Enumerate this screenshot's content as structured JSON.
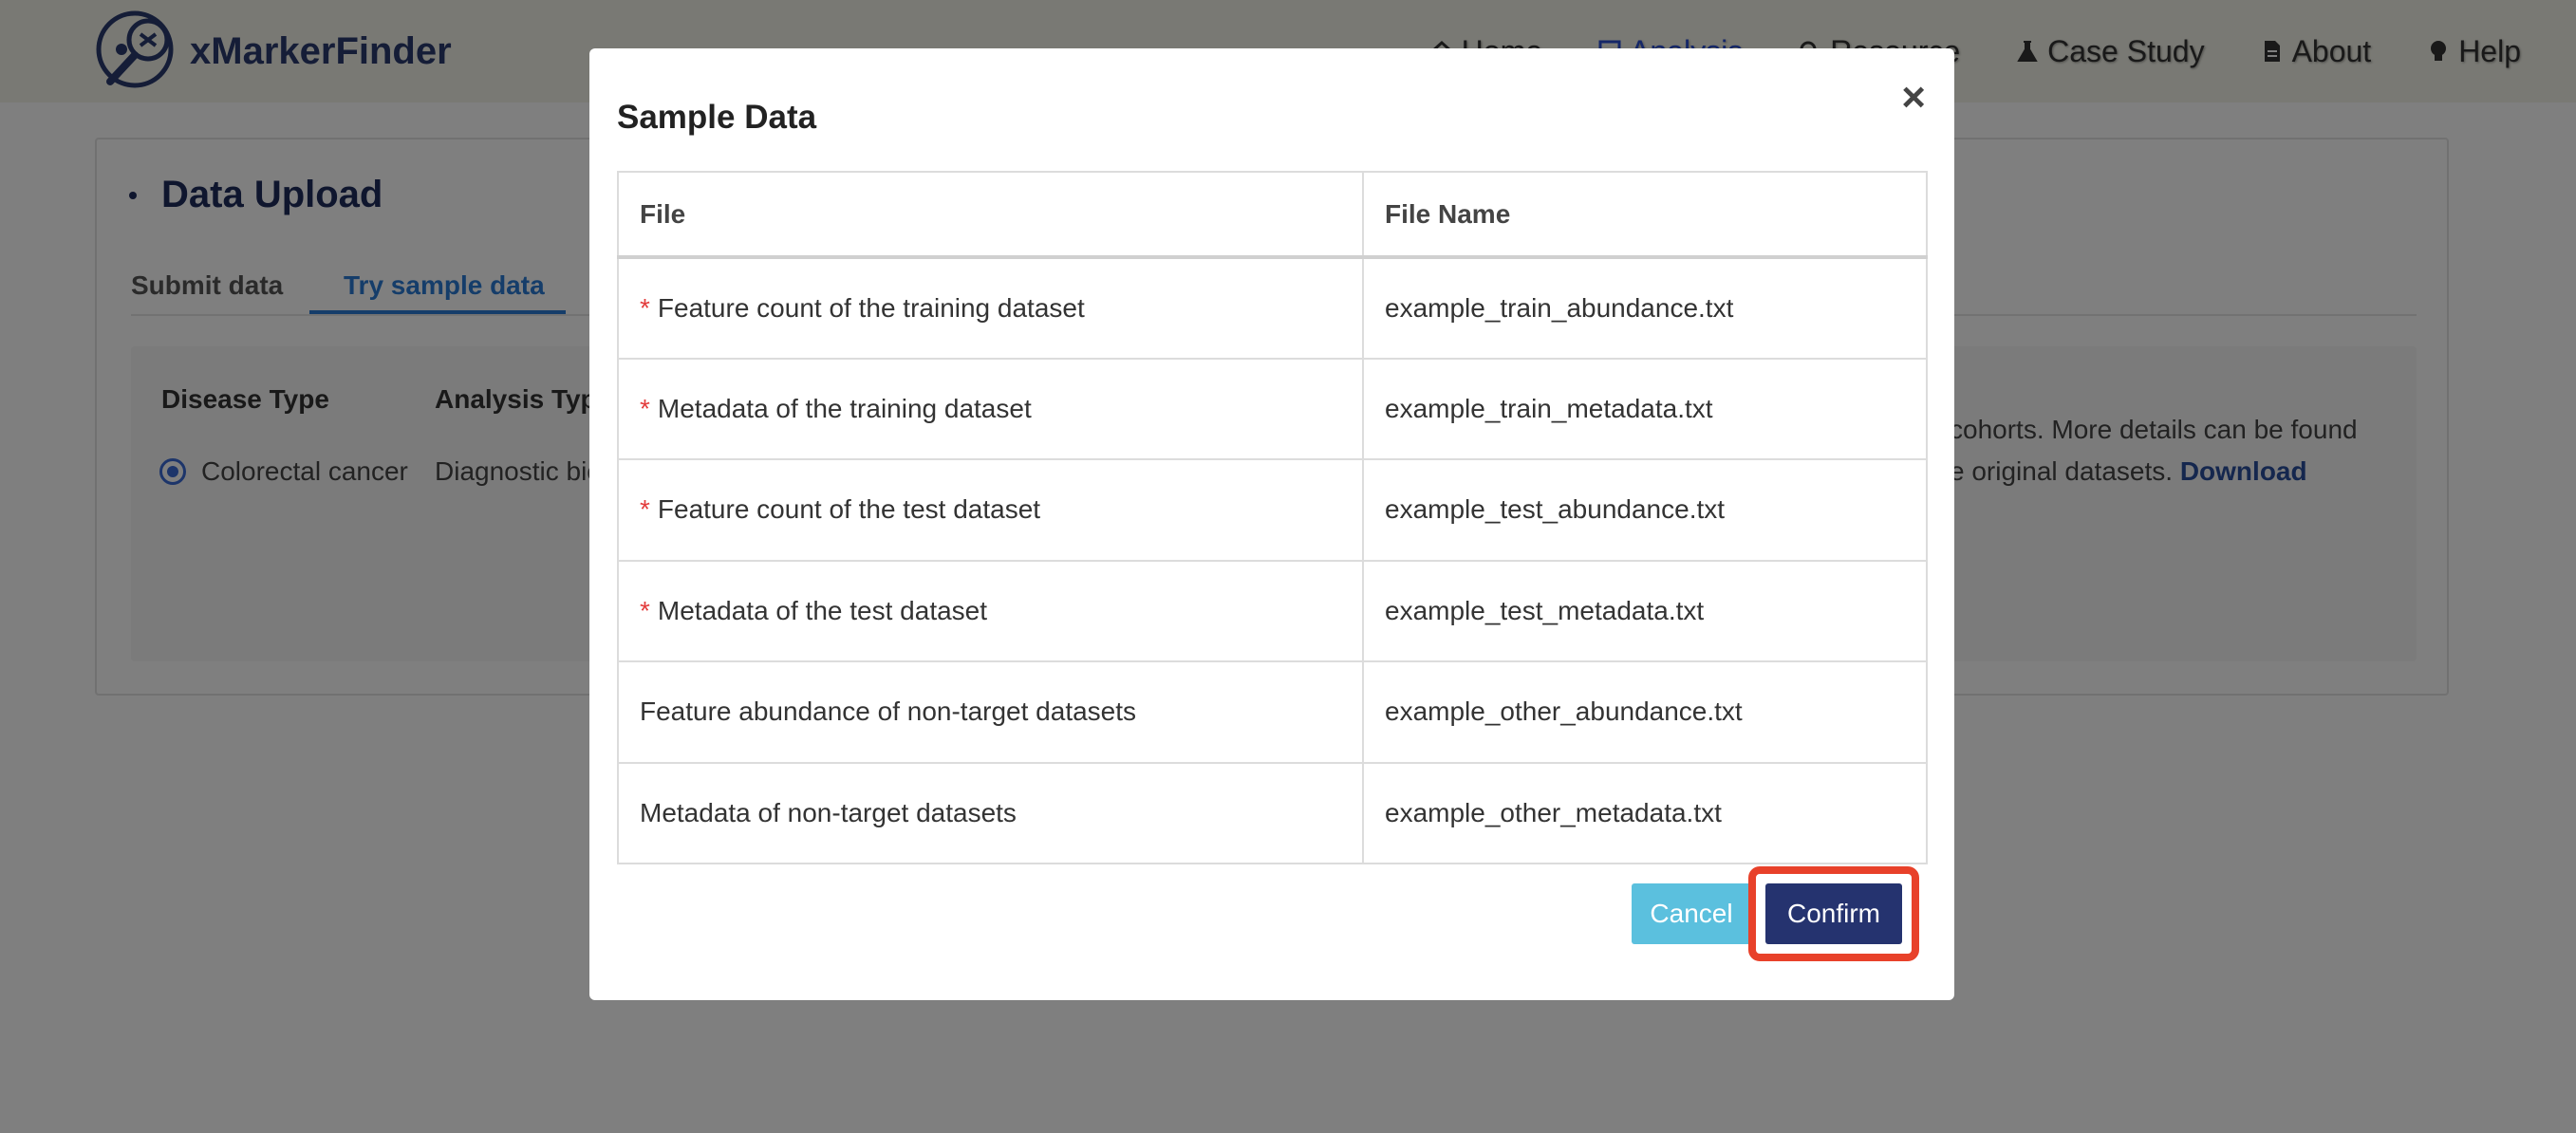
{
  "brand": {
    "name": "xMarkerFinder"
  },
  "nav": {
    "items": [
      {
        "label": "Home",
        "icon": "home-icon",
        "active": false
      },
      {
        "label": "Analysis",
        "icon": "chart-icon",
        "active": true
      },
      {
        "label": "Resource",
        "icon": "search-icon",
        "active": false
      },
      {
        "label": "Case Study",
        "icon": "flask-icon",
        "active": false
      },
      {
        "label": "About",
        "icon": "document-icon",
        "active": false
      },
      {
        "label": "Help",
        "icon": "lightbulb-icon",
        "active": false
      }
    ]
  },
  "page": {
    "title": "Data Upload",
    "tabs": [
      "Submit data",
      "Try sample data"
    ],
    "active_tab": "Try sample data",
    "columns": {
      "disease_type": "Disease Type",
      "analysis_type": "Analysis Type"
    },
    "disease_option": "Colorectal cancer",
    "analysis_value": "Diagnostic bio",
    "desc_line1": "cohorts. More details can be found",
    "desc_line2": "e original datasets.",
    "download_link": "Download"
  },
  "modal": {
    "title": "Sample Data",
    "close": "×",
    "headers": [
      "File",
      "File Name"
    ],
    "rows": [
      {
        "required": true,
        "file": "Feature count of the training dataset",
        "file_name": "example_train_abundance.txt"
      },
      {
        "required": true,
        "file": "Metadata of the training dataset",
        "file_name": "example_train_metadata.txt"
      },
      {
        "required": true,
        "file": "Feature count of the test dataset",
        "file_name": "example_test_abundance.txt"
      },
      {
        "required": true,
        "file": "Metadata of the test dataset",
        "file_name": "example_test_metadata.txt"
      },
      {
        "required": false,
        "file": "Feature abundance of non-target datasets",
        "file_name": "example_other_abundance.txt"
      },
      {
        "required": false,
        "file": "Metadata of non-target datasets",
        "file_name": "example_other_metadata.txt"
      }
    ],
    "required_marker": "*",
    "cancel_label": "Cancel",
    "confirm_label": "Confirm"
  },
  "colors": {
    "brand": "#2a3a6f",
    "confirm": "#25336f",
    "cancel": "#5bc0de",
    "required": "#e33c3c",
    "highlight": "#e8412a",
    "link": "#2a7bd4"
  }
}
